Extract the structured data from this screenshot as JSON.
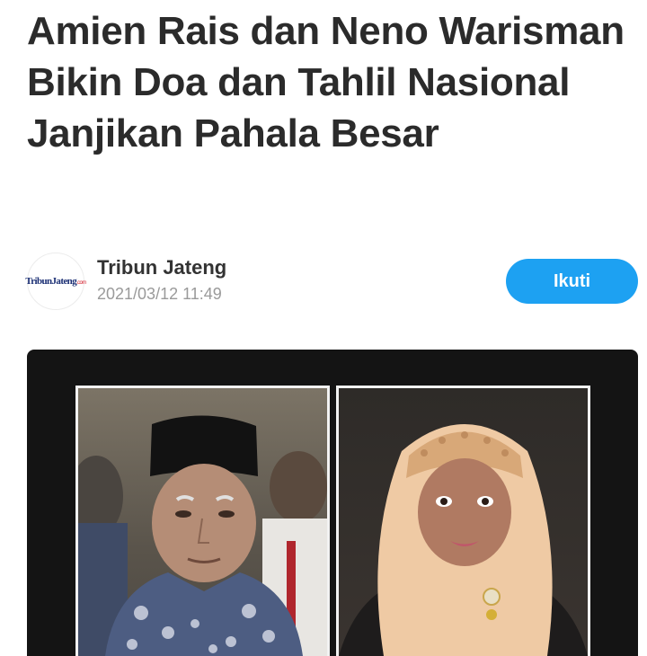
{
  "article": {
    "title": "Amien Rais dan Neno Warisman Bikin Doa dan Tahlil Nasional Janjikan Pahala Besar"
  },
  "source": {
    "logo_text": "TribunJateng",
    "logo_suffix": ".com",
    "name": "Tribun Jateng",
    "timestamp": "2021/03/12 11:49",
    "follow_label": "Ikuti"
  },
  "colors": {
    "accent": "#1da1f2",
    "title": "#2b2b2b",
    "meta": "#9a9a9a",
    "media_bg": "#141414"
  }
}
